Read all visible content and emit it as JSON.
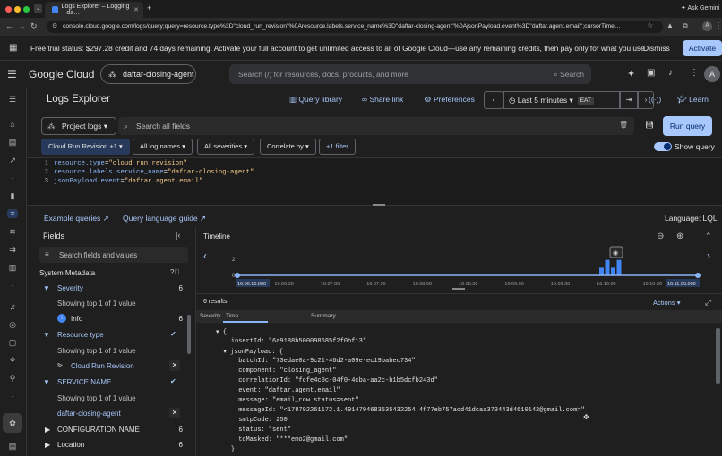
{
  "browser": {
    "tab_title": "Logs Explorer – Logging – da…",
    "url": "console.cloud.google.com/logs/query;query=resource.type%3D\"cloud_run_revision\"%0Aresource.labels.service_name%3D\"daftar-closing-agent\"%0AjsonPayload.event%3D\"daftar.agent.email\";cursorTime…",
    "ask_gemini": "Ask Gemini"
  },
  "banner": {
    "text": "Free trial status: $297.28 credit and 74 days remaining. Activate your full account to get unlimited access to all of Google Cloud—use any remaining credits, then pay only for what you use.",
    "dismiss": "Dismiss",
    "activate": "Activate"
  },
  "header": {
    "logo": "Google Cloud",
    "project": "daftar-closing-agent",
    "search_placeholder": "Search (/) for resources, docs, products, and more",
    "search_button": "Search",
    "avatar": "A"
  },
  "toolbar": {
    "title": "Logs Explorer",
    "query_library": "Query library",
    "share_link": "Share link",
    "preferences": "Preferences",
    "time_range": "Last 5 minutes",
    "timezone": "EAT",
    "learn": "Learn"
  },
  "query": {
    "project_logs": "Project logs",
    "search_all_fields": "Search all fields",
    "run_query": "Run query",
    "chips": [
      "Cloud Run Revision +1",
      "All log names",
      "All severities",
      "Correlate by",
      "+1 filter"
    ],
    "show_query": "Show query",
    "lines": [
      {
        "n": "1",
        "key": "resource.type",
        "val": "\"cloud_run_revision\""
      },
      {
        "n": "2",
        "key": "resource.labels.service_name",
        "val": "\"daftar-closing-agent\""
      },
      {
        "n": "3",
        "key": "jsonPayload.event",
        "val": "\"daftar.agent.email\""
      }
    ]
  },
  "links": {
    "example_queries": "Example queries",
    "query_language_guide": "Query language guide",
    "language": "Language: LQL"
  },
  "fields": {
    "title": "Fields",
    "search_placeholder": "Search fields and values",
    "system_metadata": "System Metadata",
    "severity": {
      "label": "Severity",
      "count": "6",
      "showing": "Showing top 1 of 1 value",
      "value": "Info",
      "value_count": "6"
    },
    "resource_type": {
      "label": "Resource type",
      "showing": "Showing top 1 of 1 value",
      "value": "Cloud Run Revision"
    },
    "service_name": {
      "label": "SERVICE NAME",
      "showing": "Showing top 1 of 1 value",
      "value": "daftar-closing-agent"
    },
    "configuration_name": {
      "label": "CONFIGURATION NAME",
      "count": "6"
    },
    "location": {
      "label": "Location",
      "count": "6"
    }
  },
  "timeline": {
    "title": "Timeline",
    "y_ticks": [
      "2",
      "0"
    ],
    "x_ticks": [
      "16:06:10.000",
      "16:06:30",
      "16:07:00",
      "16:07:30",
      "16:08:00",
      "16:08:30",
      "16:09:00",
      "16:09:30",
      "16:10:00",
      "16:10:30",
      "16:11:05.000"
    ]
  },
  "chart_data": {
    "type": "bar",
    "title": "Timeline",
    "ylim": [
      0,
      3
    ],
    "categories": [
      "16:10:20",
      "16:10:25",
      "16:10:30",
      "16:10:35"
    ],
    "values": [
      1,
      2,
      1,
      2
    ]
  },
  "results": {
    "count": "6 results",
    "actions": "Actions",
    "columns": [
      "Severity",
      "Time",
      "Summary"
    ],
    "json_lines": [
      "▾ {",
      "    insertId: \"6a9188b500098685f2f0bf13\"",
      "  ▾ jsonPayload: {",
      "      batchId: \"73edae0a-9c21-46d2-a09e-ec19babec734\"",
      "      component: \"closing_agent\"",
      "      correlationId: \"fcfe4c0c-04f0-4cba-aa2c-b1b5dcfb243d\"",
      "      event: \"daftar.agent.email\"",
      "      message: \"email_row status=sent\"",
      "      messageId: \"<178792261172.1.4914794683535432254.4f77eb757acd41dcaa373443d4610142@gmail.com>\"",
      "      smtpCode: 250",
      "      status: \"sent\"",
      "      toMasked: \"***emo2@gmail.com\"",
      "    }"
    ]
  },
  "colors": {
    "accent": "#a8c7fa",
    "bar": "#4285f4",
    "bg": "#1f1f1f"
  }
}
